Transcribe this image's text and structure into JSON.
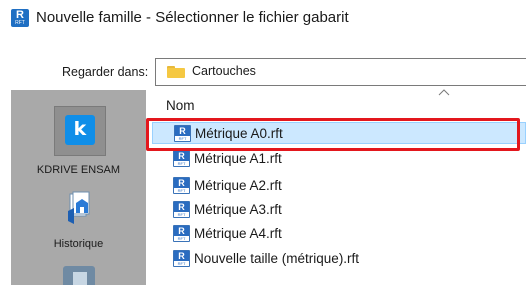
{
  "window": {
    "title": "Nouvelle famille - Sélectionner le fichier gabarit",
    "app_icon": "revit-rft-icon"
  },
  "look_in": {
    "label": "Regarder dans:",
    "value": "Cartouches",
    "icon": "folder-icon"
  },
  "places": [
    {
      "label": "KDRIVE ENSAM",
      "icon": "kdrive-icon"
    },
    {
      "label": "Historique",
      "icon": "history-icon"
    },
    {
      "label": "",
      "icon": "desktop-icon"
    }
  ],
  "file_list": {
    "column_name": "Nom",
    "sort": "ascending",
    "files": [
      {
        "name": "Métrique A0.rft",
        "selected": true
      },
      {
        "name": "Métrique A1.rft",
        "selected": false
      },
      {
        "name": "Métrique A2.rft",
        "selected": false
      },
      {
        "name": "Métrique A3.rft",
        "selected": false
      },
      {
        "name": "Métrique A4.rft",
        "selected": false
      },
      {
        "name": "Nouvelle taille (métrique).rft",
        "selected": false
      }
    ]
  },
  "colors": {
    "selection_fill": "#cce8ff",
    "highlight_box": "#e3171d",
    "places_bar": "#a9a9a9",
    "revit_blue": "#2a6cc0"
  }
}
